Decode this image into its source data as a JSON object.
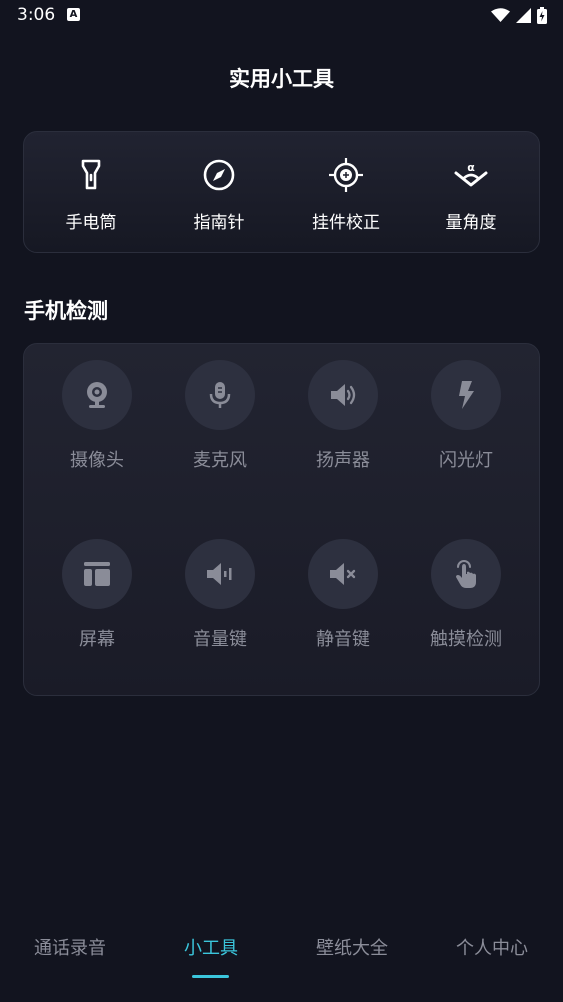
{
  "status_bar": {
    "time": "3:06",
    "notification_icon": "a-text-icon"
  },
  "page": {
    "title": "实用小工具"
  },
  "tools": [
    {
      "label": "手电筒",
      "icon": "flashlight-icon"
    },
    {
      "label": "指南针",
      "icon": "compass-icon"
    },
    {
      "label": "挂件校正",
      "icon": "crosshair-icon"
    },
    {
      "label": "量角度",
      "icon": "protractor-icon"
    }
  ],
  "detection": {
    "title": "手机检测",
    "items": [
      {
        "label": "摄像头",
        "icon": "webcam-icon"
      },
      {
        "label": "麦克风",
        "icon": "microphone-icon"
      },
      {
        "label": "扬声器",
        "icon": "speaker-icon"
      },
      {
        "label": "闪光灯",
        "icon": "flash-icon"
      },
      {
        "label": "屏幕",
        "icon": "screen-icon"
      },
      {
        "label": "音量键",
        "icon": "volume-key-icon"
      },
      {
        "label": "静音键",
        "icon": "mute-icon"
      },
      {
        "label": "触摸检测",
        "icon": "touch-icon"
      }
    ]
  },
  "bottom_nav": {
    "tabs": [
      "通话录音",
      "小工具",
      "壁纸大全",
      "个人中心"
    ],
    "active_index": 1
  },
  "colors": {
    "background": "#12141f",
    "accent": "#3bc6dc",
    "muted_text": "#8a8c98",
    "icon_circle": "#2d303f"
  }
}
